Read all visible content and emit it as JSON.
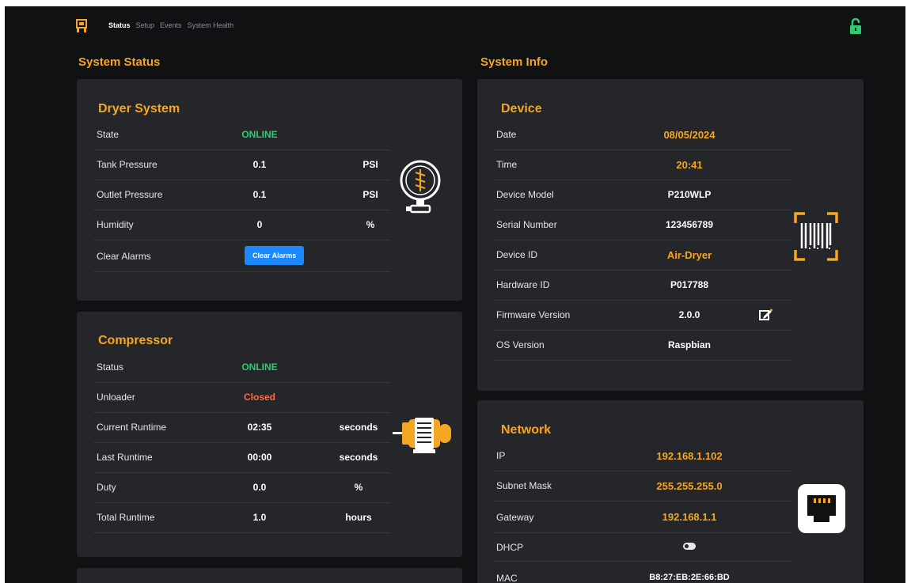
{
  "nav": {
    "tabs": [
      "Status",
      "Setup",
      "Events",
      "System Health"
    ],
    "active": "Status"
  },
  "left": {
    "section_title": "System Status",
    "dryer": {
      "title": "Dryer System",
      "rows": {
        "state": {
          "label": "State",
          "value": "ONLINE"
        },
        "tank": {
          "label": "Tank Pressure",
          "value": "0.1",
          "unit": "PSI"
        },
        "outlet": {
          "label": "Outlet Pressure",
          "value": "0.1",
          "unit": "PSI"
        },
        "humidity": {
          "label": "Humidity",
          "value": "0",
          "unit": "%"
        },
        "clear": {
          "label": "Clear Alarms",
          "button": "Clear Alarms"
        }
      }
    },
    "compressor": {
      "title": "Compressor",
      "rows": {
        "status": {
          "label": "Status",
          "value": "ONLINE"
        },
        "unloader": {
          "label": "Unloader",
          "value": "Closed"
        },
        "current": {
          "label": "Current Runtime",
          "value": "02:35",
          "unit": "seconds"
        },
        "last": {
          "label": "Last Runtime",
          "value": "00:00",
          "unit": "seconds"
        },
        "duty": {
          "label": "Duty",
          "value": "0.0",
          "unit": "%"
        },
        "total": {
          "label": "Total Runtime",
          "value": "1.0",
          "unit": "hours"
        }
      }
    }
  },
  "right": {
    "section_title": "System Info",
    "device": {
      "title": "Device",
      "rows": {
        "date": {
          "label": "Date",
          "value": "08/05/2024"
        },
        "time": {
          "label": "Time",
          "value": "20:41"
        },
        "model": {
          "label": "Device Model",
          "value": "P210WLP"
        },
        "serial": {
          "label": "Serial Number",
          "value": "123456789"
        },
        "device_id": {
          "label": "Device ID",
          "value": "Air-Dryer"
        },
        "hardware_id": {
          "label": "Hardware ID",
          "value": "P017788"
        },
        "firmware": {
          "label": "Firmware Version",
          "value": "2.0.0"
        },
        "os": {
          "label": "OS Version",
          "value": "Raspbian"
        }
      }
    },
    "network": {
      "title": "Network",
      "rows": {
        "ip": {
          "label": "IP",
          "value": "192.168.1.102"
        },
        "subnet": {
          "label": "Subnet Mask",
          "value": "255.255.255.0"
        },
        "gateway": {
          "label": "Gateway",
          "value": "192.168.1.1"
        },
        "dhcp": {
          "label": "DHCP",
          "enabled": true
        },
        "mac": {
          "label": "MAC",
          "value": "B8:27:EB:2E:66:BD"
        }
      }
    }
  },
  "colors": {
    "accent": "#f5a623",
    "online": "#2ecc71",
    "closed": "#ff6b4a",
    "button": "#1e88ff",
    "lock": "#2ecc71",
    "card": "#242629",
    "background": "#101113"
  },
  "icons": [
    "logo-icon",
    "unlocked-lock-icon",
    "pressure-gauge-icon",
    "motor-icon",
    "barcode-scanner-icon",
    "ethernet-port-icon",
    "edit-icon"
  ]
}
